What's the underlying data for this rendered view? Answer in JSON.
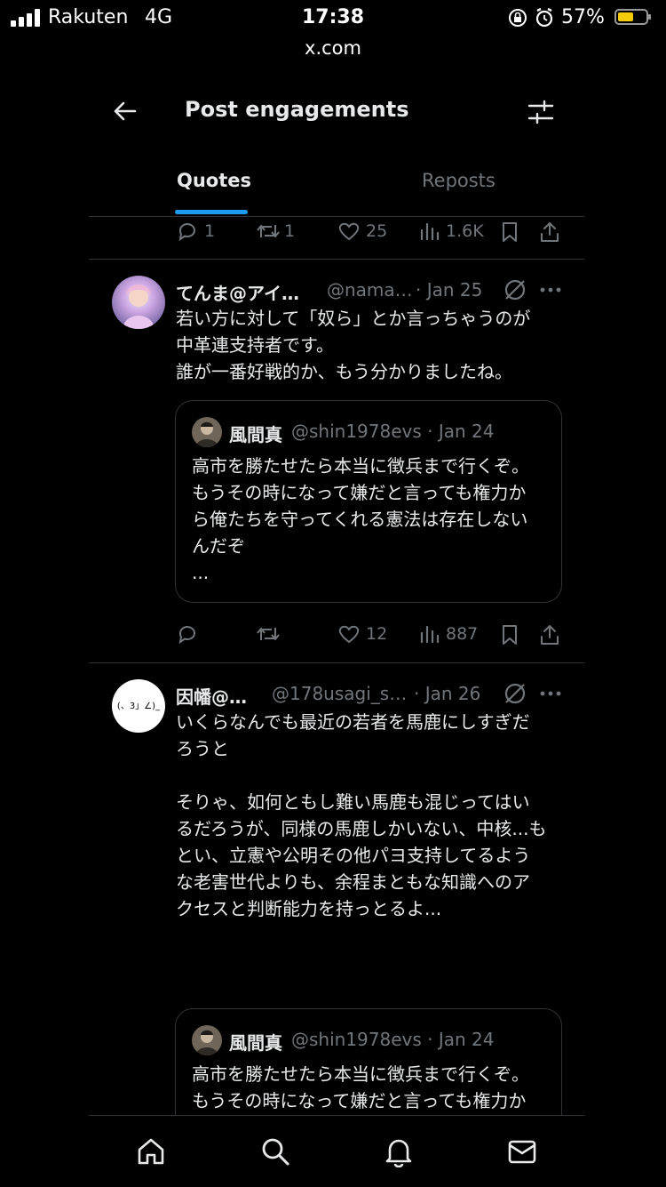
{
  "status_bar": {
    "carrier": "Rakuten",
    "network": "4G",
    "time": "17:38",
    "battery_pct": "57%",
    "battery_level": 0.57,
    "battery_color": "#f5cc0c"
  },
  "browser": {
    "url": "x.com"
  },
  "header": {
    "title": "Post engagements"
  },
  "tabs": [
    {
      "label": "Quotes",
      "active": true
    },
    {
      "label": "Reposts",
      "active": false
    }
  ],
  "colors": {
    "accent": "#1d9bf0",
    "muted": "#71767b",
    "text": "#e7e9ea",
    "border": "#2f3336"
  },
  "prev_post_actions": {
    "replies": "1",
    "reposts": "1",
    "likes": "25",
    "views": "1.6K"
  },
  "posts": [
    {
      "name": "てんま@アイ…",
      "handle": "@nama…",
      "date": "· Jan 25",
      "text": "若い方に対して「奴ら」とか言っちゃうのが\n中革連支持者です。\n誰が一番好戦的か、もう分かりましたね。",
      "quote": {
        "name": "風間真",
        "meta": "@shin1978evs · Jan 24",
        "text": "高市を勝たせたら本当に徴兵まで行くぞ。\nもうその時になって嫌だと言っても権力か\nら俺たちを守ってくれる憲法は存在しない\nんだぞ\n..."
      },
      "actions": {
        "replies": "",
        "reposts": "",
        "likes": "12",
        "views": "887"
      }
    },
    {
      "name": "因幡@…",
      "handle": "@178usagi_s…",
      "date": "· Jan 26",
      "avatar_text": "(、3」∠)_",
      "text": "いくらなんでも最近の若者を馬鹿にしすぎだ\nろうと\n\nそりゃ、如何ともし難い馬鹿も混じってはい\nるだろうが、同様の馬鹿しかいない、中核...も\nとい、立憲や公明その他パヨ支持してるよう\nな老害世代よりも、余程まともな知識へのア\nクセスと判断能力を持っとるよ...",
      "quote": {
        "name": "風間真",
        "meta": "@shin1978evs · Jan 24",
        "text": "高市を勝たせたら本当に徴兵まで行くぞ。\nもうその時になって嫌だと言っても権力か\nら俺たちを守ってくれる憲法は存在しない\nんだぞ\n..."
      }
    }
  ],
  "bottom_nav": [
    "home-icon",
    "search-icon",
    "bell-icon",
    "mail-icon"
  ]
}
